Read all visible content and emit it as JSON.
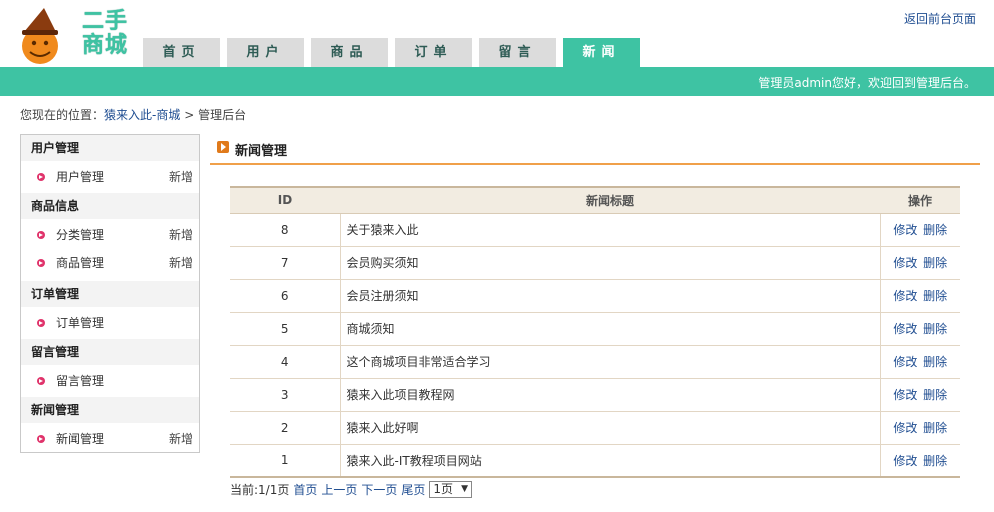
{
  "header": {
    "logo_text_line1": "二手",
    "logo_text_line2": "商城",
    "back_link": "返回前台页面",
    "tabs": [
      {
        "label": "首页",
        "active": false
      },
      {
        "label": "用户",
        "active": false
      },
      {
        "label": "商品",
        "active": false
      },
      {
        "label": "订单",
        "active": false
      },
      {
        "label": "留言",
        "active": false
      },
      {
        "label": "新闻",
        "active": true
      }
    ],
    "welcome": "管理员admin您好，欢迎回到管理后台。"
  },
  "breadcrumb": {
    "prefix": "您现在的位置：",
    "link": "猿来入此-商城",
    "separator": ">",
    "current": "管理后台"
  },
  "sidebar": {
    "groups": [
      {
        "title": "用户管理",
        "items": [
          {
            "label": "用户管理",
            "add": "新增"
          }
        ]
      },
      {
        "title": "商品信息",
        "items": [
          {
            "label": "分类管理",
            "add": "新增"
          },
          {
            "label": "商品管理",
            "add": "新增"
          }
        ]
      },
      {
        "title": "订单管理",
        "items": [
          {
            "label": "订单管理",
            "add": ""
          }
        ]
      },
      {
        "title": "留言管理",
        "items": [
          {
            "label": "留言管理",
            "add": ""
          }
        ]
      },
      {
        "title": "新闻管理",
        "items": [
          {
            "label": "新闻管理",
            "add": "新增"
          }
        ]
      }
    ]
  },
  "content": {
    "title": "新闻管理",
    "table": {
      "headers": [
        "ID",
        "新闻标题",
        "操作"
      ],
      "rows": [
        {
          "id": "8",
          "title": "关于猿来入此",
          "edit": "修改",
          "delete": "删除"
        },
        {
          "id": "7",
          "title": "会员购买须知",
          "edit": "修改",
          "delete": "删除"
        },
        {
          "id": "6",
          "title": "会员注册须知",
          "edit": "修改",
          "delete": "删除"
        },
        {
          "id": "5",
          "title": "商城须知",
          "edit": "修改",
          "delete": "删除"
        },
        {
          "id": "4",
          "title": "这个商城项目非常适合学习",
          "edit": "修改",
          "delete": "删除"
        },
        {
          "id": "3",
          "title": "猿来入此项目教程网",
          "edit": "修改",
          "delete": "删除"
        },
        {
          "id": "2",
          "title": "猿来入此好啊",
          "edit": "修改",
          "delete": "删除"
        },
        {
          "id": "1",
          "title": "猿来入此-IT教程项目网站",
          "edit": "修改",
          "delete": "删除"
        }
      ]
    },
    "pager": {
      "status": "当前:1/1页",
      "first": "首页",
      "prev": "上一页",
      "next": "下一页",
      "last": "尾页",
      "select_value": "1页"
    }
  },
  "colors": {
    "accent": "#3ec3a3",
    "link": "#1f4d91",
    "title_underline": "#f0a04a"
  }
}
